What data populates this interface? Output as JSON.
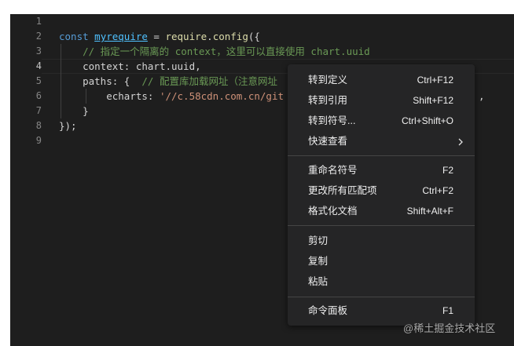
{
  "gutter": {
    "line_numbers": [
      "1",
      "2",
      "3",
      "4",
      "5",
      "6",
      "7",
      "8",
      "9"
    ]
  },
  "code": {
    "l2_const": "const",
    "l2_var": "myrequire",
    "l2_eq": " = ",
    "l2_require": "require",
    "l2_dot": ".",
    "l2_config": "config",
    "l2_open": "({",
    "l3_comment": "// 指定一个隔离的 context，这里可以直接使用 chart.uuid",
    "l4_text": "context: chart.uuid,",
    "l5_paths": "paths: {  ",
    "l5_comment": "// 配置库加载网址（注意网址",
    "l6_key": "echarts: ",
    "l6_str": "'//c.58cdn.com.cn/git",
    "l6_tail": ",",
    "l7_text": "}",
    "l8_text": "});"
  },
  "context_menu": {
    "group1": [
      {
        "label": "转到定义",
        "shortcut": "Ctrl+F12"
      },
      {
        "label": "转到引用",
        "shortcut": "Shift+F12"
      },
      {
        "label": "转到符号...",
        "shortcut": "Ctrl+Shift+O"
      },
      {
        "label": "快速查看",
        "submenu_icon": "chevron-right-icon"
      }
    ],
    "group2": [
      {
        "label": "重命名符号",
        "shortcut": "F2"
      },
      {
        "label": "更改所有匹配项",
        "shortcut": "Ctrl+F2"
      },
      {
        "label": "格式化文档",
        "shortcut": "Shift+Alt+F"
      }
    ],
    "group3": [
      {
        "label": "剪切"
      },
      {
        "label": "复制"
      },
      {
        "label": "粘贴"
      }
    ],
    "group4": [
      {
        "label": "命令面板",
        "shortcut": "F1"
      }
    ]
  },
  "watermark": "@稀土掘金技术社区",
  "colors": {
    "editor_bg": "#1e1e1e",
    "menu_bg": "#252526",
    "keyword": "#569cd6",
    "variable": "#4fc1ff",
    "function": "#dcdcaa",
    "comment": "#6a9955",
    "string": "#ce9178"
  }
}
